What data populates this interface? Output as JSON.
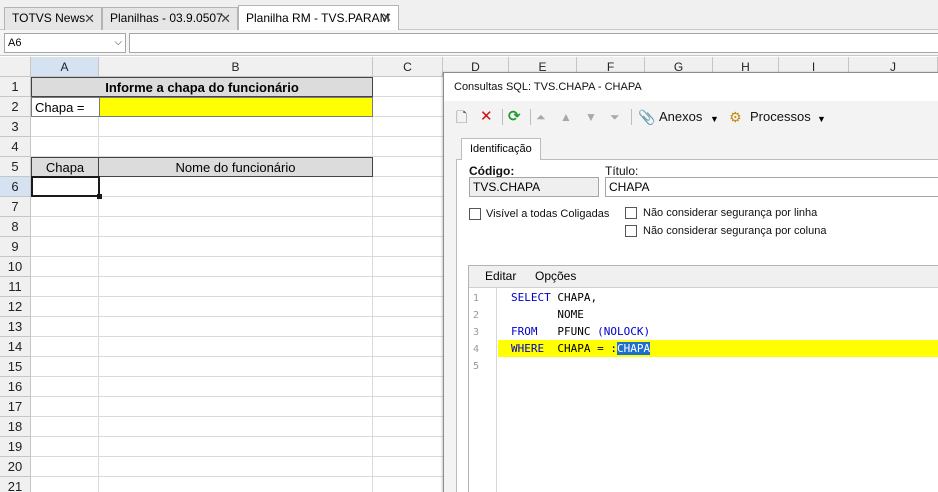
{
  "tabs": [
    {
      "label": "TOTVS News"
    },
    {
      "label": "Planilhas - 03.9.0507"
    },
    {
      "label": "Planilha RM - TVS.PARAM"
    }
  ],
  "formula_bar": {
    "name_box": "A6",
    "formula": ""
  },
  "sheet": {
    "columns": [
      "A",
      "B",
      "C",
      "D",
      "E",
      "F",
      "G",
      "H",
      "I",
      "J"
    ],
    "rows": [
      "1",
      "2",
      "3",
      "4",
      "5",
      "6",
      "7",
      "8",
      "9",
      "10",
      "11",
      "12",
      "13",
      "14",
      "15",
      "16",
      "17",
      "18",
      "19",
      "20",
      "21"
    ],
    "title_cell": "Informe a chapa do funcionário",
    "chapa_label": "Chapa =",
    "chapa_value": "",
    "header_chapa": "Chapa",
    "header_nome": "Nome do funcionário"
  },
  "dialog": {
    "title": "Consultas SQL: TVS.CHAPA - CHAPA",
    "toolbar": {
      "anexos": "Anexos",
      "processos": "Processos"
    },
    "tab": "Identificação",
    "codigo_label": "Código:",
    "codigo_value": "TVS.CHAPA",
    "titulo_label": "Título:",
    "titulo_value": "CHAPA",
    "chk_visivel": "Visível a todas Coligadas",
    "chk_linha": "Não considerar segurança por linha",
    "chk_coluna": "Não considerar segurança por coluna",
    "editor_menu": {
      "editar": "Editar",
      "opcoes": "Opções"
    },
    "line_numbers": [
      "1",
      "2",
      "3",
      "4",
      "5"
    ],
    "sql": {
      "l1_kw": "SELECT",
      "l1_rest": " CHAPA,",
      "l2": "       NOME",
      "l3_kw": "FROM",
      "l3_mid": "   PFUNC ",
      "l3_par1": "(",
      "l3_kw2": "NOLOCK",
      "l3_par2": ")",
      "l4_kw": "WHERE",
      "l4_mid": "  CHAPA = :",
      "l4_sel": "CHAPA"
    }
  }
}
